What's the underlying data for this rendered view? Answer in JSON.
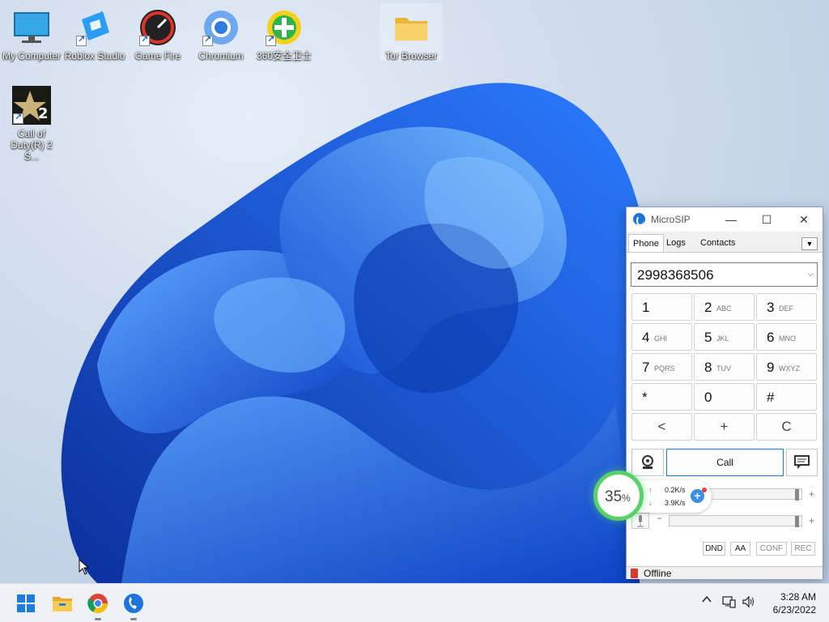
{
  "desktop": {
    "icons": [
      {
        "label": "My Computer",
        "icon": "monitor-icon"
      },
      {
        "label": "Roblox Studio",
        "icon": "roblox-studio-icon"
      },
      {
        "label": "Game Fire",
        "icon": "game-fire-icon"
      },
      {
        "label": "Chromium",
        "icon": "chromium-icon"
      },
      {
        "label": "360安全卫士",
        "icon": "360-security-icon"
      },
      {
        "label": "Tor Browser",
        "icon": "folder-icon"
      },
      {
        "label": "Call of Duty(R) 2 S...",
        "icon": "call-of-duty-icon"
      }
    ]
  },
  "microsip": {
    "title": "MicroSIP",
    "tabs": [
      "Phone",
      "Logs",
      "Contacts"
    ],
    "active_tab": "Phone",
    "number_value": "2998368506",
    "keys": [
      {
        "digit": "1",
        "sub": ""
      },
      {
        "digit": "2",
        "sub": "ABC"
      },
      {
        "digit": "3",
        "sub": "DEF"
      },
      {
        "digit": "4",
        "sub": "GHI"
      },
      {
        "digit": "5",
        "sub": "JKL"
      },
      {
        "digit": "6",
        "sub": "MNO"
      },
      {
        "digit": "7",
        "sub": "PQRS"
      },
      {
        "digit": "8",
        "sub": "TUV"
      },
      {
        "digit": "9",
        "sub": "WXYZ"
      },
      {
        "digit": "*",
        "sub": ""
      },
      {
        "digit": "0",
        "sub": ""
      },
      {
        "digit": "#",
        "sub": ""
      }
    ],
    "actions": {
      "back": "<",
      "plus": "+",
      "clear": "C"
    },
    "call_label": "Call",
    "slider_minus": "−",
    "slider_plus": "+",
    "flags": [
      "DND",
      "AA",
      "CONF",
      "REC"
    ],
    "status": "Offline",
    "speaker_level": 0.98,
    "mic_level": 0.98
  },
  "network_widget": {
    "percent": "35",
    "percent_unit": "%",
    "upload": "0.2K/s",
    "download": "3.9K/s",
    "up_arrow": "↑",
    "down_arrow": "↓"
  },
  "taskbar": {
    "time": "3:28 AM",
    "date": "6/23/2022",
    "tray_chevron": "^"
  },
  "colors": {
    "accent": "#1e74d8",
    "wallpaper_blue": "#1a5fe0",
    "offline": "#d43a2f",
    "widget_ring": "#5ad06a"
  }
}
